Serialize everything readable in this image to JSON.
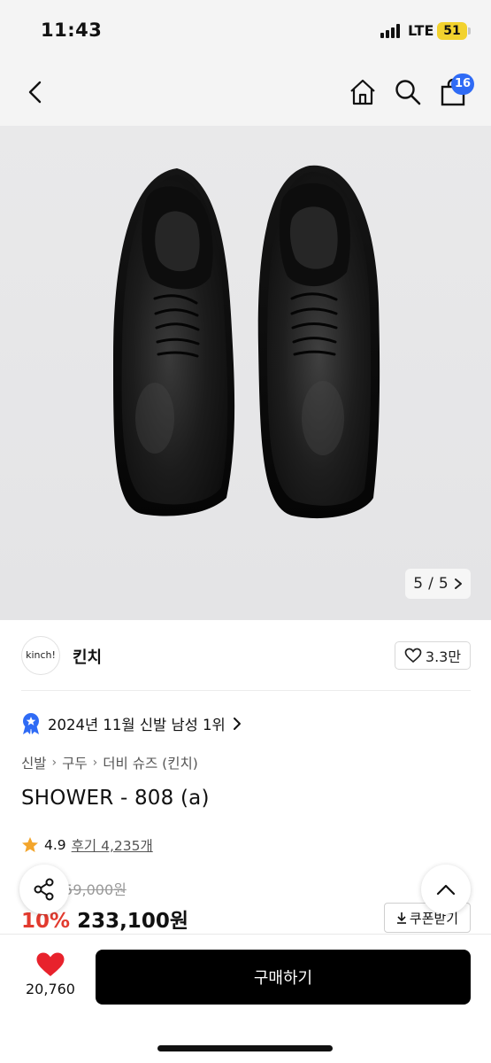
{
  "status_bar": {
    "time": "11:43",
    "network": "LTE",
    "battery": "51"
  },
  "nav": {
    "back_icon": "chevron-left-icon",
    "home_icon": "home-icon",
    "search_icon": "search-icon",
    "cart_icon": "shopping-bag-icon",
    "cart_count": "16"
  },
  "gallery": {
    "current": "5",
    "separator": "/",
    "total": "5",
    "next_icon": "chevron-right-icon"
  },
  "brand": {
    "logo_text": "kinch!",
    "name": "킨치",
    "like_count": "3.3만"
  },
  "ranking": {
    "text": "2024년 11월 신발 남성 1위"
  },
  "breadcrumb": [
    "신발",
    "구두",
    "더비 슈즈 (킨치)"
  ],
  "product": {
    "title": "SHOWER - 808 (a)"
  },
  "rating": {
    "score": "4.9",
    "reviews": "후기 4,235개"
  },
  "price": {
    "original": "259,000원",
    "discount": "10%",
    "sale": "233,100원",
    "coupon_label": "쿠폰받기"
  },
  "bottom": {
    "wish_count": "20,760",
    "buy_label": "구매하기"
  },
  "colors": {
    "accent_blue": "#2f6bf5",
    "discount_red": "#e23a2e",
    "heart_red": "#e8222c",
    "star_orange": "#f3a52b",
    "battery_yellow": "#f2d22e"
  }
}
